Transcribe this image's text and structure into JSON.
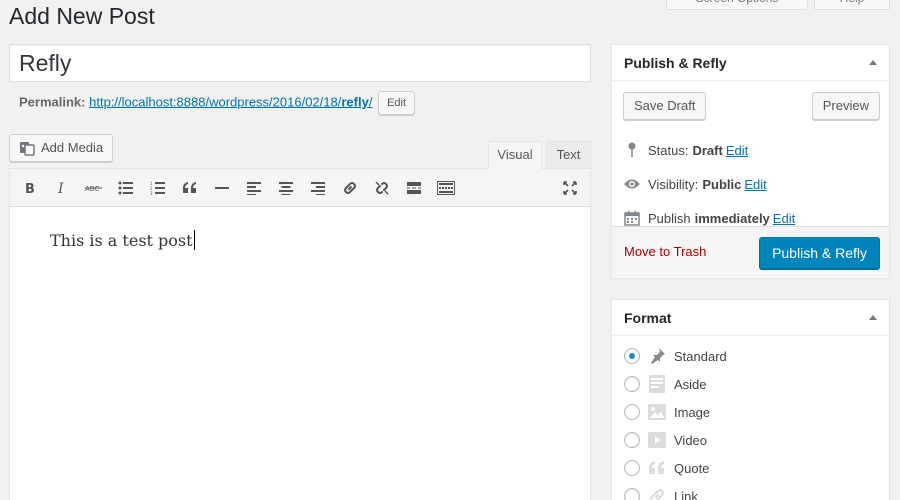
{
  "header": {
    "title": "Add New Post",
    "screen_options_label": "Screen Options",
    "help_label": "Help"
  },
  "post": {
    "title_value": "Refly",
    "permalink_label": "Permalink:",
    "permalink_url_prefix": "http://localhost:8888/wordpress/2016/02/18/",
    "permalink_slug": "refly",
    "permalink_url_suffix": "/",
    "permalink_edit_label": "Edit",
    "body_text": "This is a test post"
  },
  "editor": {
    "add_media_label": "Add Media",
    "tab_visual": "Visual",
    "tab_text": "Text",
    "toolbar": [
      "bold-icon",
      "italic-icon",
      "strikethrough-icon",
      "bulleted-list-icon",
      "numbered-list-icon",
      "blockquote-icon",
      "horizontal-line-icon",
      "align-left-icon",
      "align-center-icon",
      "align-right-icon",
      "insert-link-icon",
      "remove-link-icon",
      "read-more-icon",
      "toolbar-toggle-icon",
      "fullscreen-icon"
    ]
  },
  "publish_box": {
    "title": "Publish & Refly",
    "save_draft_label": "Save Draft",
    "preview_label": "Preview",
    "status_label": "Status:",
    "status_value": "Draft",
    "status_edit": "Edit",
    "visibility_label": "Visibility:",
    "visibility_value": "Public",
    "visibility_edit": "Edit",
    "publish_label": "Publish",
    "publish_value": "immediately",
    "publish_edit": "Edit",
    "trash_label": "Move to Trash",
    "publish_button_label": "Publish & Refly"
  },
  "format_box": {
    "title": "Format",
    "selected": "Standard",
    "options": [
      {
        "label": "Standard",
        "icon": "pin-icon"
      },
      {
        "label": "Aside",
        "icon": "aside-icon"
      },
      {
        "label": "Image",
        "icon": "image-icon"
      },
      {
        "label": "Video",
        "icon": "video-icon"
      },
      {
        "label": "Quote",
        "icon": "quote-icon"
      },
      {
        "label": "Link",
        "icon": "link-icon"
      }
    ]
  },
  "colors": {
    "primary": "#0085ba",
    "link": "#0073aa",
    "trash": "#aa0000"
  }
}
